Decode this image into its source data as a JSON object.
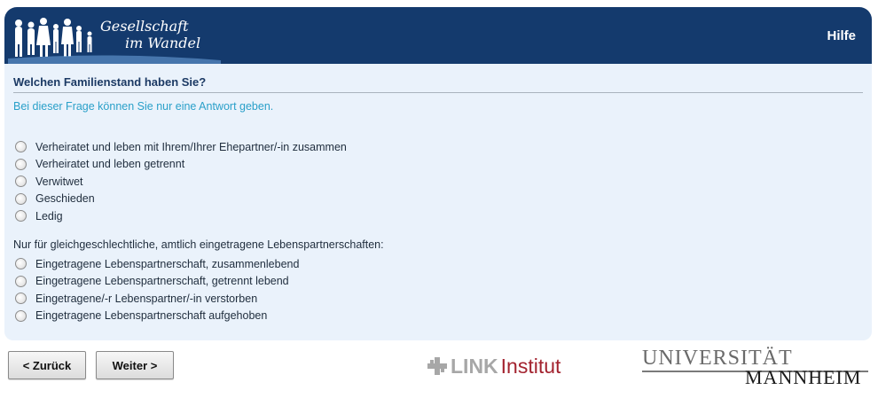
{
  "header": {
    "logo_line1": "Gesellschaft",
    "logo_line2": "im Wandel",
    "help_label": "Hilfe"
  },
  "question": {
    "title": "Welchen Familienstand haben Sie?",
    "instruction": "Bei dieser Frage können Sie nur eine Antwort geben.",
    "options": [
      "Verheiratet und leben mit Ihrem/Ihrer Ehepartner/-in zusammen",
      "Verheiratet und leben getrennt",
      "Verwitwet",
      "Geschieden",
      "Ledig"
    ],
    "subheading": "Nur für gleichgeschlechtliche, amtlich eingetragene Lebenspartnerschaften:",
    "options2": [
      "Eingetragene Lebenspartnerschaft, zusammenlebend",
      "Eingetragene Lebenspartnerschaft, getrennt lebend",
      "Eingetragene/-r Lebenspartner/-in verstorben",
      "Eingetragene Lebenspartnerschaft aufgehoben"
    ]
  },
  "nav": {
    "back_label": "< Zurück",
    "next_label": "Weiter >"
  },
  "footer": {
    "link_word": "LINK",
    "institut_word": "Institut",
    "uni_line1": "UNIVERSITÄT",
    "uni_line2": "MANNHEIM"
  },
  "colors": {
    "header_bg": "#143a6d",
    "content_bg": "#eaf2fb",
    "instruction": "#2aa0c9",
    "link_red": "#a3232f"
  }
}
